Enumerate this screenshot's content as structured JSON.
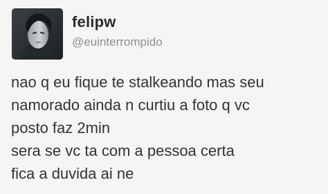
{
  "tweet": {
    "author": {
      "display_name": "felipw",
      "handle": "@euinterrompido",
      "avatar_icon": "profile-photo"
    },
    "text_lines": [
      "nao q eu fique te stalkeando mas seu",
      "namorado ainda n curtiu a foto q vc",
      "posto faz 2min",
      "sera se vc ta com a pessoa certa",
      "fica a duvida ai ne"
    ]
  },
  "colors": {
    "background": "#f5f5f5",
    "name": "#2b2b2b",
    "handle": "#8a8f94",
    "text": "#333333"
  }
}
